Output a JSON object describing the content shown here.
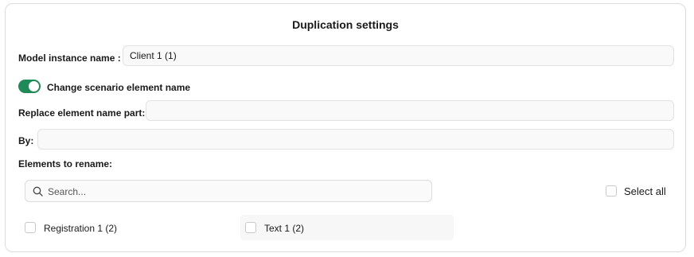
{
  "dialog": {
    "title": "Duplication settings"
  },
  "model_instance": {
    "label": "Model instance name :",
    "value": "Client 1 (1)"
  },
  "toggle": {
    "label": "Change scenario element name",
    "state": "on",
    "color": "#1e8a57"
  },
  "replace": {
    "label": "Replace element name part:",
    "value": ""
  },
  "by": {
    "label": "By:",
    "value": ""
  },
  "elements": {
    "label": "Elements to rename:",
    "search_placeholder": "Search...",
    "search_icon": "search-icon",
    "select_all_label": "Select all",
    "items": [
      {
        "label": "Registration 1 (2)",
        "checked": false
      },
      {
        "label": "Text 1 (2)",
        "checked": false
      }
    ]
  }
}
